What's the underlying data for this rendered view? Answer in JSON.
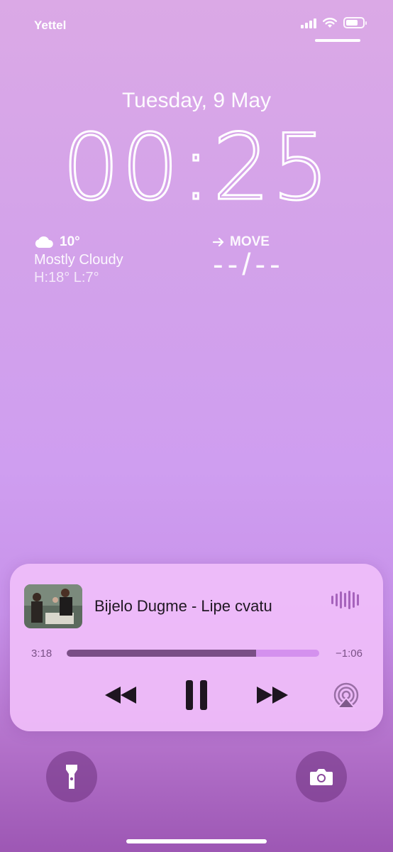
{
  "status_bar": {
    "carrier": "Yettel"
  },
  "lock_screen": {
    "date": "Tuesday, 9 May",
    "time": "00:25"
  },
  "weather_widget": {
    "temperature": "10°",
    "condition": "Mostly Cloudy",
    "high_low": "H:18° L:7°",
    "icon": "cloud-icon"
  },
  "activity_widget": {
    "label": "MOVE",
    "value": "--/--",
    "icon": "arrow-right-icon"
  },
  "now_playing": {
    "title": "Bijelo Dugme - Lipe cvatu",
    "elapsed": "3:18",
    "remaining": "−1:06",
    "progress": 0.75,
    "accent_color": "#7a4f86",
    "track_color": "#d491ee"
  },
  "quick_actions": {
    "left_icon": "flashlight-icon",
    "right_icon": "camera-icon"
  }
}
